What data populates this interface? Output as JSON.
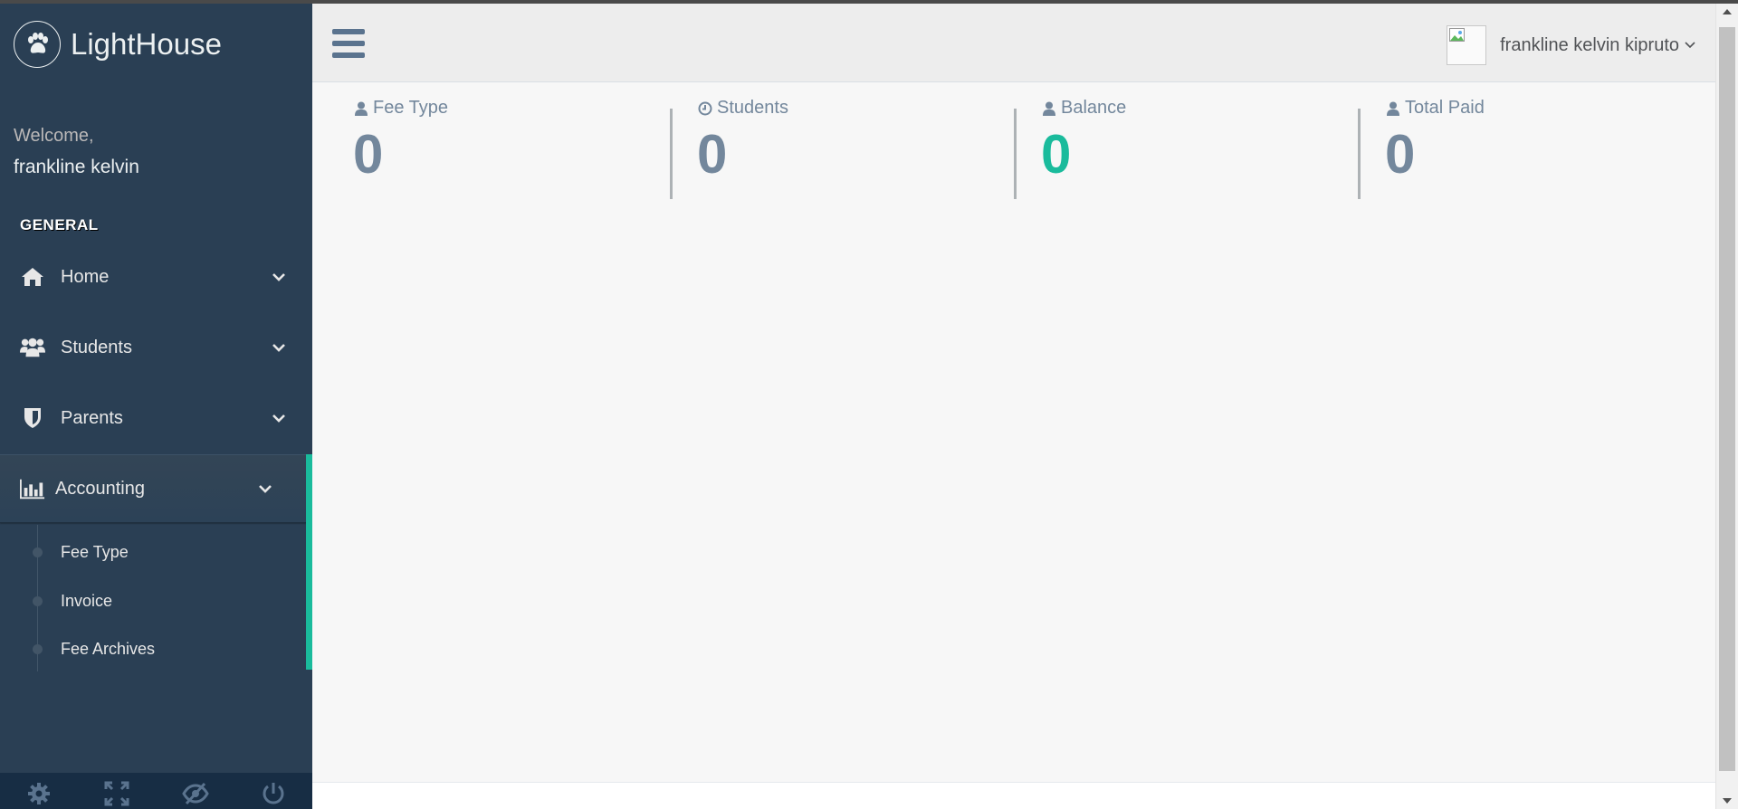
{
  "brand": {
    "name": "LightHouse",
    "icon": "paw-icon"
  },
  "sidebar": {
    "welcome": "Welcome,",
    "user_name": "frankline kelvin",
    "section_title": "GENERAL",
    "menu": [
      {
        "label": "Home",
        "icon": "home-icon"
      },
      {
        "label": "Students",
        "icon": "users-icon"
      },
      {
        "label": "Parents",
        "icon": "shield-icon"
      },
      {
        "label": "Accounting",
        "icon": "bar-chart-icon",
        "active": true
      }
    ],
    "submenu": [
      {
        "label": "Fee Type"
      },
      {
        "label": "Invoice"
      },
      {
        "label": "Fee Archives"
      }
    ],
    "footer_icons": [
      "gear-icon",
      "fullscreen-icon",
      "eye-slash-icon",
      "power-icon"
    ]
  },
  "topnav": {
    "user_full_name": "frankline kelvin kipruto",
    "avatar_alt": ""
  },
  "stats": [
    {
      "label": "Fee Type",
      "value": "0",
      "icon": "user-icon"
    },
    {
      "label": "Students",
      "value": "0",
      "icon": "clock-icon"
    },
    {
      "label": "Balance",
      "value": "0",
      "icon": "user-icon",
      "highlight": "#1ABB9C"
    },
    {
      "label": "Total Paid",
      "value": "0",
      "icon": "user-icon"
    }
  ],
  "colors": {
    "sidebar_bg": "#2A3F54",
    "accent": "#1ABB9C",
    "muted_text": "#73879C",
    "topnav_bg": "#EDEDED"
  }
}
